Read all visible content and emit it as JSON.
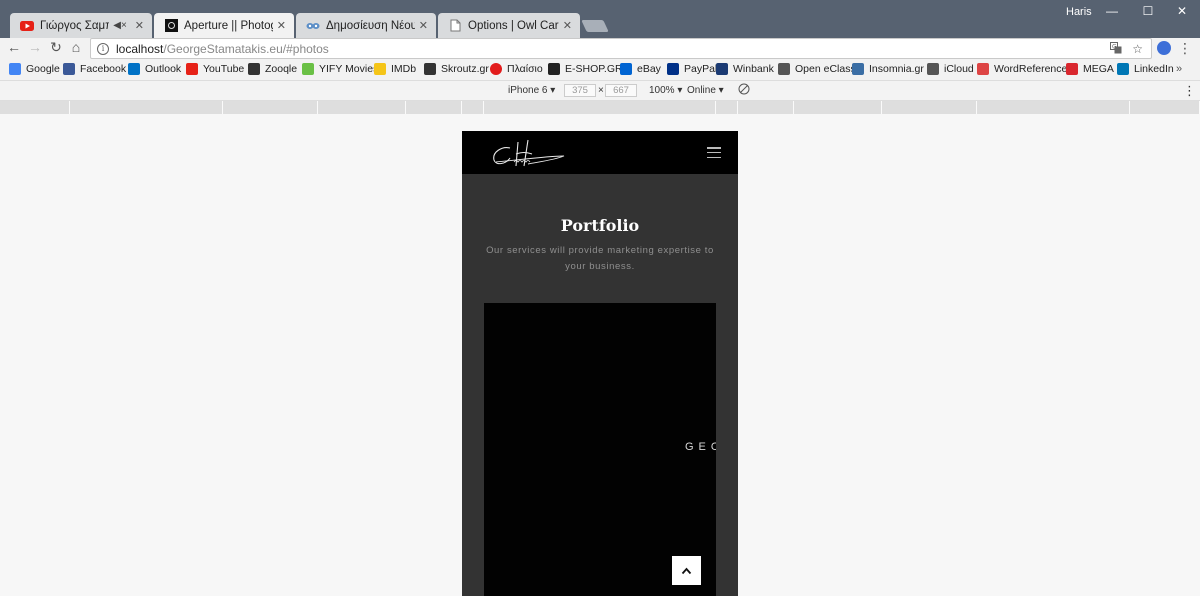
{
  "browser": {
    "tabs": [
      {
        "title": "Γιώργος Σαμπάνης -",
        "favicon": "youtube-icon",
        "muted": true
      },
      {
        "title": "Aperture || Photography",
        "favicon": "aperture-icon",
        "active": true
      },
      {
        "title": "Δημοσίευση Νέου Θέμα",
        "favicon": "forum-icon"
      },
      {
        "title": "Options | Owl Carousel |",
        "favicon": "page-icon"
      }
    ],
    "profile_name": "Haris",
    "url_host": "localhost",
    "url_path": "/GeorgeStamatakis.eu/#photos",
    "bookmarks": [
      {
        "label": "Google",
        "icon": "google-icon",
        "color": "#4285f4"
      },
      {
        "label": "Facebook",
        "icon": "facebook-icon",
        "color": "#3b5998"
      },
      {
        "label": "Outlook",
        "icon": "outlook-icon",
        "color": "#0072c6"
      },
      {
        "label": "YouTube",
        "icon": "youtube-icon",
        "color": "#e62117"
      },
      {
        "label": "Zooqle",
        "icon": "zooqle-icon",
        "color": "#333333"
      },
      {
        "label": "YIFY Movies",
        "icon": "yify-icon",
        "color": "#6ac045"
      },
      {
        "label": "IMDb",
        "icon": "imdb-icon",
        "color": "#f5c518"
      },
      {
        "label": "Skroutz.gr",
        "icon": "skroutz-icon",
        "color": "#333333"
      },
      {
        "label": "Πλαίσιο",
        "icon": "plaisio-icon",
        "color": "#e21b1b"
      },
      {
        "label": "E-SHOP.GR",
        "icon": "eshop-icon",
        "color": "#222222"
      },
      {
        "label": "eBay",
        "icon": "ebay-icon",
        "color": "#0064d2"
      },
      {
        "label": "PayPal",
        "icon": "paypal-icon",
        "color": "#003087"
      },
      {
        "label": "Winbank",
        "icon": "winbank-icon",
        "color": "#1b3a73"
      },
      {
        "label": "Open eClass",
        "icon": "eclass-icon",
        "color": "#555555"
      },
      {
        "label": "Insomnia.gr",
        "icon": "insomnia-icon",
        "color": "#3b6ea5"
      },
      {
        "label": "iCloud",
        "icon": "apple-icon",
        "color": "#555555"
      },
      {
        "label": "WordReference",
        "icon": "wordreference-icon",
        "color": "#d44"
      },
      {
        "label": "MEGA",
        "icon": "mega-icon",
        "color": "#d9272e"
      },
      {
        "label": "LinkedIn",
        "icon": "linkedin-icon",
        "color": "#0077b5"
      }
    ],
    "bookmarks_more": "»"
  },
  "device_toolbar": {
    "device": "iPhone 6",
    "width": "375",
    "height": "667",
    "zoom": "100%",
    "network": "Online"
  },
  "site": {
    "section_title": "Portfolio",
    "section_subtitle": "Our services will provide marketing expertise to your business.",
    "carousel_text": "GEO",
    "header_bg": "#000000",
    "body_bg": "#333333"
  }
}
